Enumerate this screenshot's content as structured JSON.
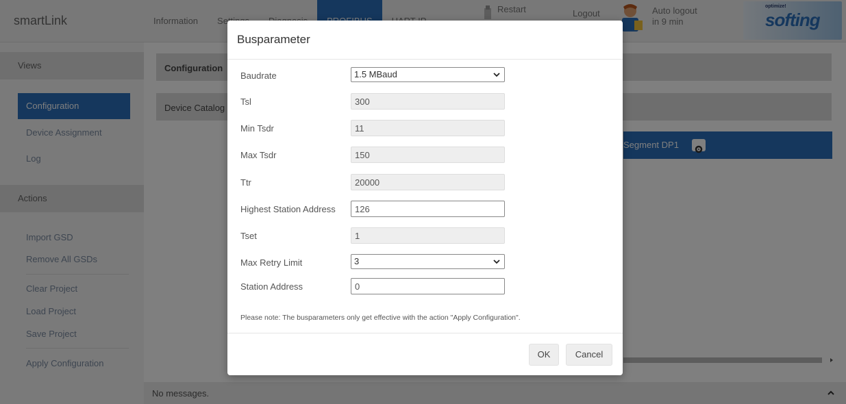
{
  "app": {
    "brand": "smartLink"
  },
  "nav": [
    {
      "label": "Information"
    },
    {
      "label": "Settings"
    },
    {
      "label": "Diagnosis"
    },
    {
      "label": "PROFIBUS"
    },
    {
      "label": "HART IP"
    }
  ],
  "header": {
    "restart": "Restart",
    "logout": "Logout",
    "auto_logout_line1": "Auto logout",
    "auto_logout_line2": "in 9 min",
    "logo_small": "optimize!",
    "logo_big": "softing"
  },
  "sidebar": {
    "views_title": "Views",
    "views": [
      "Configuration",
      "Device Assignment",
      "Log"
    ],
    "actions_title": "Actions",
    "actions": [
      "Import GSD",
      "Remove All GSDs",
      "Clear Project",
      "Load Project",
      "Save Project",
      "Apply Configuration"
    ]
  },
  "main": {
    "configuration_tab": "Configuration",
    "device_catalog": "Device Catalog",
    "segment": "Segment DP1"
  },
  "footer": {
    "messages": "No messages."
  },
  "dialog": {
    "title": "Busparameter",
    "fields": {
      "baudrate": {
        "label": "Baudrate",
        "value": "1.5 MBaud"
      },
      "tsl": {
        "label": "Tsl",
        "value": "300"
      },
      "min_tsdr": {
        "label": "Min Tsdr",
        "value": "11"
      },
      "max_tsdr": {
        "label": "Max Tsdr",
        "value": "150"
      },
      "ttr": {
        "label": "Ttr",
        "value": "20000"
      },
      "highest_station": {
        "label": "Highest Station Address",
        "value": "126"
      },
      "tset": {
        "label": "Tset",
        "value": "1"
      },
      "max_retry": {
        "label": "Max Retry Limit",
        "value": "3"
      },
      "station_address": {
        "label": "Station Address",
        "value": "0"
      }
    },
    "note": "Please note: The busparameters only get effective with the action \"Apply Configuration\".",
    "ok": "OK",
    "cancel": "Cancel"
  },
  "colors": {
    "accent": "#2a6ebb",
    "overlay": "rgba(0,0,0,0.5)"
  }
}
